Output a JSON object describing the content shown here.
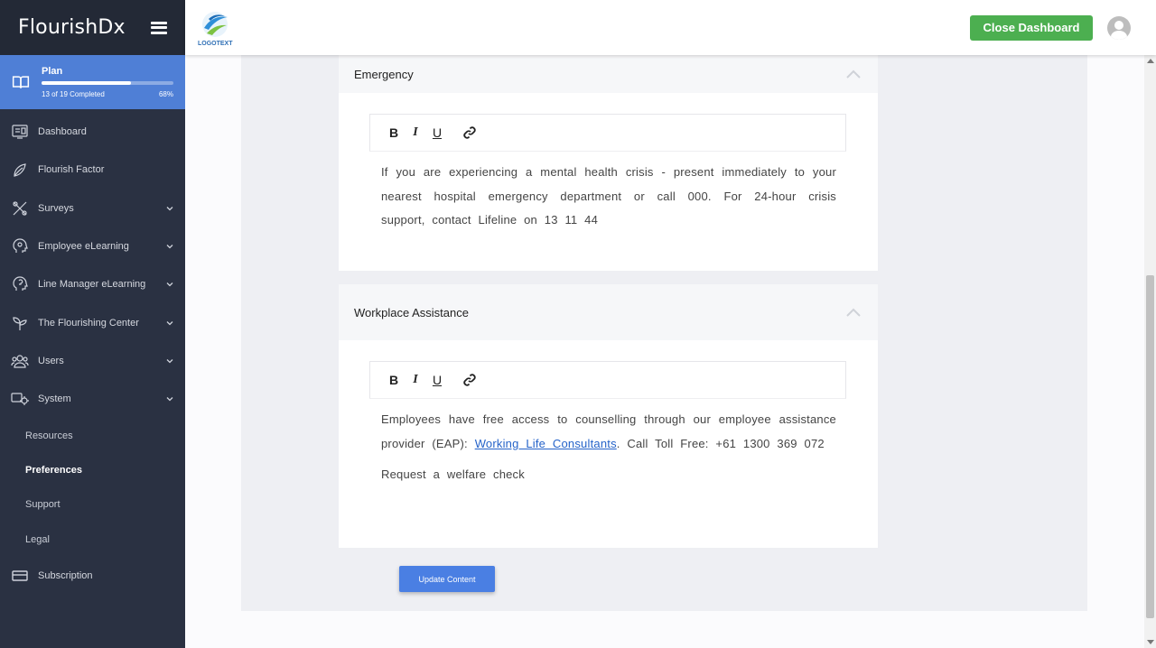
{
  "sidebar": {
    "brand": "FlourishDx",
    "plan": {
      "title": "Plan",
      "progress_text": "13 of 19 Completed",
      "percent_text": "68%",
      "progress_fraction": 0.68
    },
    "nav": [
      {
        "label": "Dashboard",
        "icon": "dashboard-icon",
        "has_children": false
      },
      {
        "label": "Flourish Factor",
        "icon": "leaf-icon",
        "has_children": false
      },
      {
        "label": "Surveys",
        "icon": "tools-icon",
        "has_children": true
      },
      {
        "label": "Employee eLearning",
        "icon": "head-gear-icon",
        "has_children": true
      },
      {
        "label": "Line Manager eLearning",
        "icon": "head-bulb-icon",
        "has_children": true
      },
      {
        "label": "The Flourishing Center",
        "icon": "sprout-icon",
        "has_children": true
      },
      {
        "label": "Users",
        "icon": "users-icon",
        "has_children": true
      },
      {
        "label": "System",
        "icon": "system-icon",
        "has_children": true
      }
    ],
    "sub_items": [
      "Resources",
      "Preferences",
      "Support",
      "Legal"
    ],
    "active_sub": "Preferences",
    "last_item": {
      "label": "Subscription",
      "icon": "subscription-icon"
    }
  },
  "header": {
    "logo_text": "LOGOTEXT",
    "close_button": "Close Dashboard"
  },
  "sections": [
    {
      "title": "Emergency",
      "toolbar": {
        "bold": "B",
        "italic": "I",
        "underline": "U"
      },
      "paragraphs": [
        "If you are experiencing a mental health crisis - present immediately to your nearest hospital emergency department or call 000. For 24-hour crisis support, contact Lifeline on 13 11 44"
      ]
    },
    {
      "title": "Workplace Assistance",
      "toolbar": {
        "bold": "B",
        "italic": "I",
        "underline": "U"
      },
      "p1_before": "Employees have free access to counselling through our employee assistance provider (EAP): ",
      "p1_link": "Working Life Consultants",
      "p1_after": ". Call Toll Free: +61 1300 369 072",
      "p2": "Request a welfare check"
    }
  ],
  "update_button": "Update Content",
  "colors": {
    "sidebar_bg": "#2a3142",
    "plan_bg": "#4f7fd6",
    "close_button": "#4caf50",
    "update_button": "#4a7fe3",
    "link": "#2563c9"
  }
}
